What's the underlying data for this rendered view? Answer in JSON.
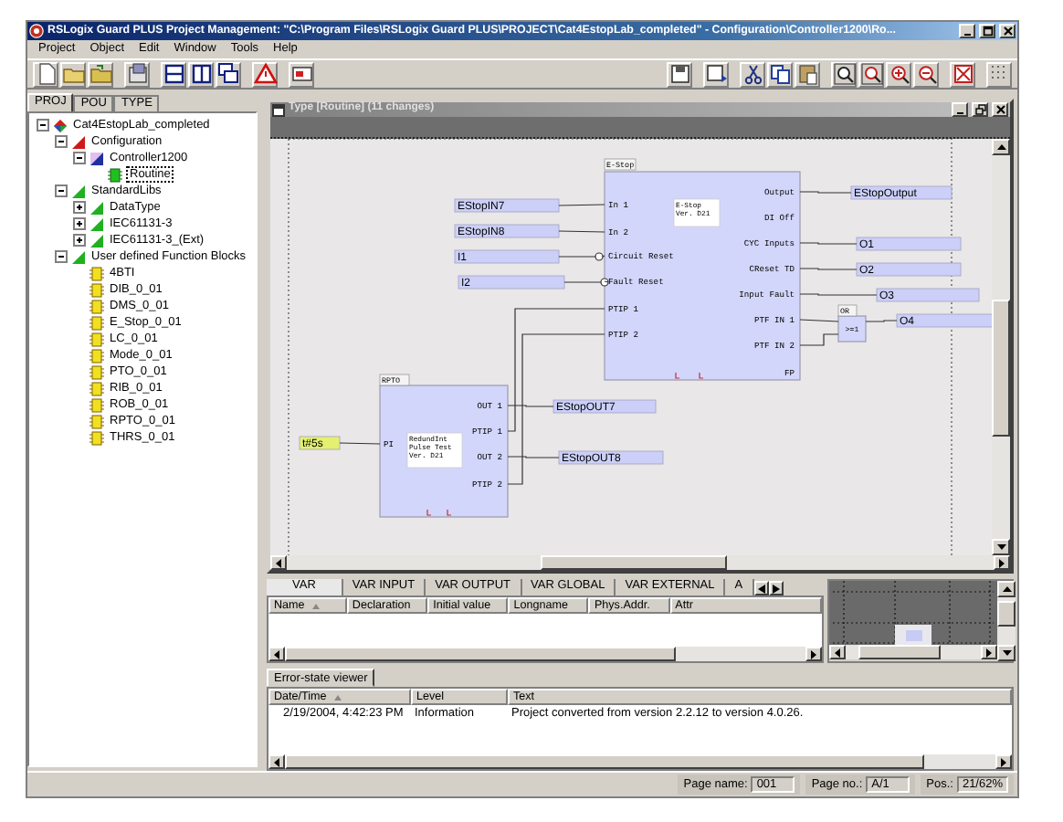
{
  "window": {
    "title": "RSLogix Guard PLUS Project Management: \"C:\\Program Files\\RSLogix Guard PLUS\\PROJECT\\Cat4EstopLab_completed\" - Configuration\\Controller1200\\Ro..."
  },
  "menu": [
    "Project",
    "Object",
    "Edit",
    "Window",
    "Tools",
    "Help"
  ],
  "project_tabs": [
    {
      "label": "PROJ",
      "selected": true
    },
    {
      "label": "POU",
      "selected": false
    },
    {
      "label": "TYPE",
      "selected": false
    }
  ],
  "tree": [
    {
      "label": "Cat4EstopLab_completed",
      "kind": "project",
      "expanded": true,
      "selected": false,
      "children": [
        {
          "label": "Configuration",
          "kind": "configuration",
          "expanded": true,
          "selected": false,
          "children": [
            {
              "label": "Controller1200",
              "kind": "controller",
              "expanded": true,
              "selected": false,
              "children": [
                {
                  "label": "Routine",
                  "kind": "routine",
                  "selected": true
                }
              ]
            }
          ]
        },
        {
          "label": "StandardLibs",
          "kind": "library",
          "expanded": true,
          "selected": false,
          "children": [
            {
              "label": "DataType",
              "kind": "library",
              "expanded": false,
              "selected": false
            },
            {
              "label": "IEC61131-3",
              "kind": "library",
              "expanded": false,
              "selected": false
            },
            {
              "label": "IEC61131-3_(Ext)",
              "kind": "library",
              "expanded": false,
              "selected": false
            }
          ]
        },
        {
          "label": "User defined Function Blocks",
          "kind": "library",
          "expanded": true,
          "selected": false,
          "children": [
            {
              "label": "4BTI",
              "kind": "function_block",
              "selected": false
            },
            {
              "label": "DIB_0_01",
              "kind": "function_block",
              "selected": false
            },
            {
              "label": "DMS_0_01",
              "kind": "function_block",
              "selected": false
            },
            {
              "label": "E_Stop_0_01",
              "kind": "function_block",
              "selected": false
            },
            {
              "label": "LC_0_01",
              "kind": "function_block",
              "selected": false
            },
            {
              "label": "Mode_0_01",
              "kind": "function_block",
              "selected": false
            },
            {
              "label": "PTO_0_01",
              "kind": "function_block",
              "selected": false
            },
            {
              "label": "RIB_0_01",
              "kind": "function_block",
              "selected": false
            },
            {
              "label": "ROB_0_01",
              "kind": "function_block",
              "selected": false
            },
            {
              "label": "RPTO_0_01",
              "kind": "function_block",
              "selected": false
            },
            {
              "label": "THRS_0_01",
              "kind": "function_block",
              "selected": false
            }
          ]
        }
      ]
    }
  ],
  "editor": {
    "title": "Type [Routine] (11 changes)",
    "blocks": [
      {
        "name": "E-Stop",
        "caption": [
          "E-Stop",
          "Ver. D21"
        ],
        "inputs": [
          "In 1",
          "In 2",
          "Circuit Reset",
          "Fault Reset",
          "PTIP 1",
          "PTIP 2"
        ],
        "outputs": [
          "Output",
          "DI Off",
          "CYC Inputs",
          "CReset TD",
          "Input Fault",
          "PTF IN 1",
          "PTF IN 2",
          "FP"
        ]
      },
      {
        "name": "RPTO",
        "caption": [
          "RedundInt",
          "Pulse Test",
          "Ver. D21"
        ],
        "inputs": [
          "PI"
        ],
        "outputs": [
          "OUT 1",
          "PTIP 1",
          "OUT 2",
          "PTIP 2"
        ]
      },
      {
        "name": "OR",
        "caption": [
          ">=1"
        ]
      }
    ],
    "variables": [
      {
        "name": "EStopIN7",
        "kind": "variable",
        "negated": false
      },
      {
        "name": "EStopIN8",
        "kind": "variable",
        "negated": false
      },
      {
        "name": "I1",
        "kind": "variable",
        "negated": true
      },
      {
        "name": "I2",
        "kind": "variable",
        "negated": true
      },
      {
        "name": "EStopOutput",
        "kind": "variable",
        "negated": false
      },
      {
        "name": "O1",
        "kind": "variable",
        "negated": false
      },
      {
        "name": "O2",
        "kind": "variable",
        "negated": false
      },
      {
        "name": "O3",
        "kind": "variable",
        "negated": false
      },
      {
        "name": "O4",
        "kind": "variable",
        "negated": false
      },
      {
        "name": "t#5s",
        "kind": "constant",
        "negated": false
      },
      {
        "name": "EStopOUT7",
        "kind": "variable",
        "negated": false
      },
      {
        "name": "EStopOUT8",
        "kind": "variable",
        "negated": false
      }
    ]
  },
  "var_pane": {
    "tabs": [
      {
        "label": "VAR",
        "selected": true
      },
      {
        "label": "VAR INPUT",
        "selected": false
      },
      {
        "label": "VAR OUTPUT",
        "selected": false
      },
      {
        "label": "VAR GLOBAL",
        "selected": false
      },
      {
        "label": "VAR EXTERNAL",
        "selected": false
      },
      {
        "label": "A",
        "selected": false
      }
    ],
    "columns": [
      "Name",
      "Declaration",
      "Initial value",
      "Longname",
      "Phys.Addr.",
      "Attr"
    ]
  },
  "error_viewer": {
    "tab": "Error-state viewer",
    "columns": [
      "Date/Time",
      "Level",
      "Text"
    ],
    "rows": [
      [
        "2/19/2004, 4:42:23 PM",
        "Information",
        "Project converted from version 2.2.12 to version 4.0.26."
      ]
    ]
  },
  "status_bar": [
    {
      "label": "Page name:",
      "value": "001"
    },
    {
      "label": "Page no.:",
      "value": "A/1"
    },
    {
      "label": "Pos.:",
      "value": "21/62%"
    }
  ]
}
